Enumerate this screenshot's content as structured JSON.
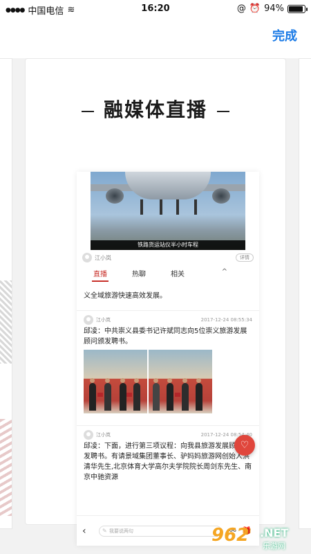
{
  "status_bar": {
    "carrier": "中国电信",
    "time": "16:20",
    "battery": "94%",
    "battery_level": 0.94
  },
  "header": {
    "done_label": "完成"
  },
  "card": {
    "title": "融媒体直播",
    "video_caption": "铁路货运站仪半小时车程",
    "author": "江小岚",
    "detail_label": "详情",
    "tabs": [
      "直播",
      "热聊",
      "相关"
    ],
    "posts": [
      {
        "text": "义全域旅游快速高效发展。"
      },
      {
        "name": "江小岚",
        "time": "2017-12-24 08:55:34",
        "text": "邱凌：中共崇义县委书记许斌同志向5位崇义旅游发展顾问颁发聘书。"
      },
      {
        "name": "江小岚",
        "time": "2017-12-24 08:54:40",
        "text": "邱凌：下面，进行第三项议程：向我县旅游发展顾问颁发聘书。有请景域集团董事长、驴妈妈旅游网创始人洪清华先生,北京体育大学高尔夫学院院长周剑东先生、南京中驰资源"
      }
    ],
    "comment_placeholder": "我要说两句"
  },
  "watermark": {
    "brand": "962",
    "net": ".NET",
    "sub": "乐游网"
  }
}
